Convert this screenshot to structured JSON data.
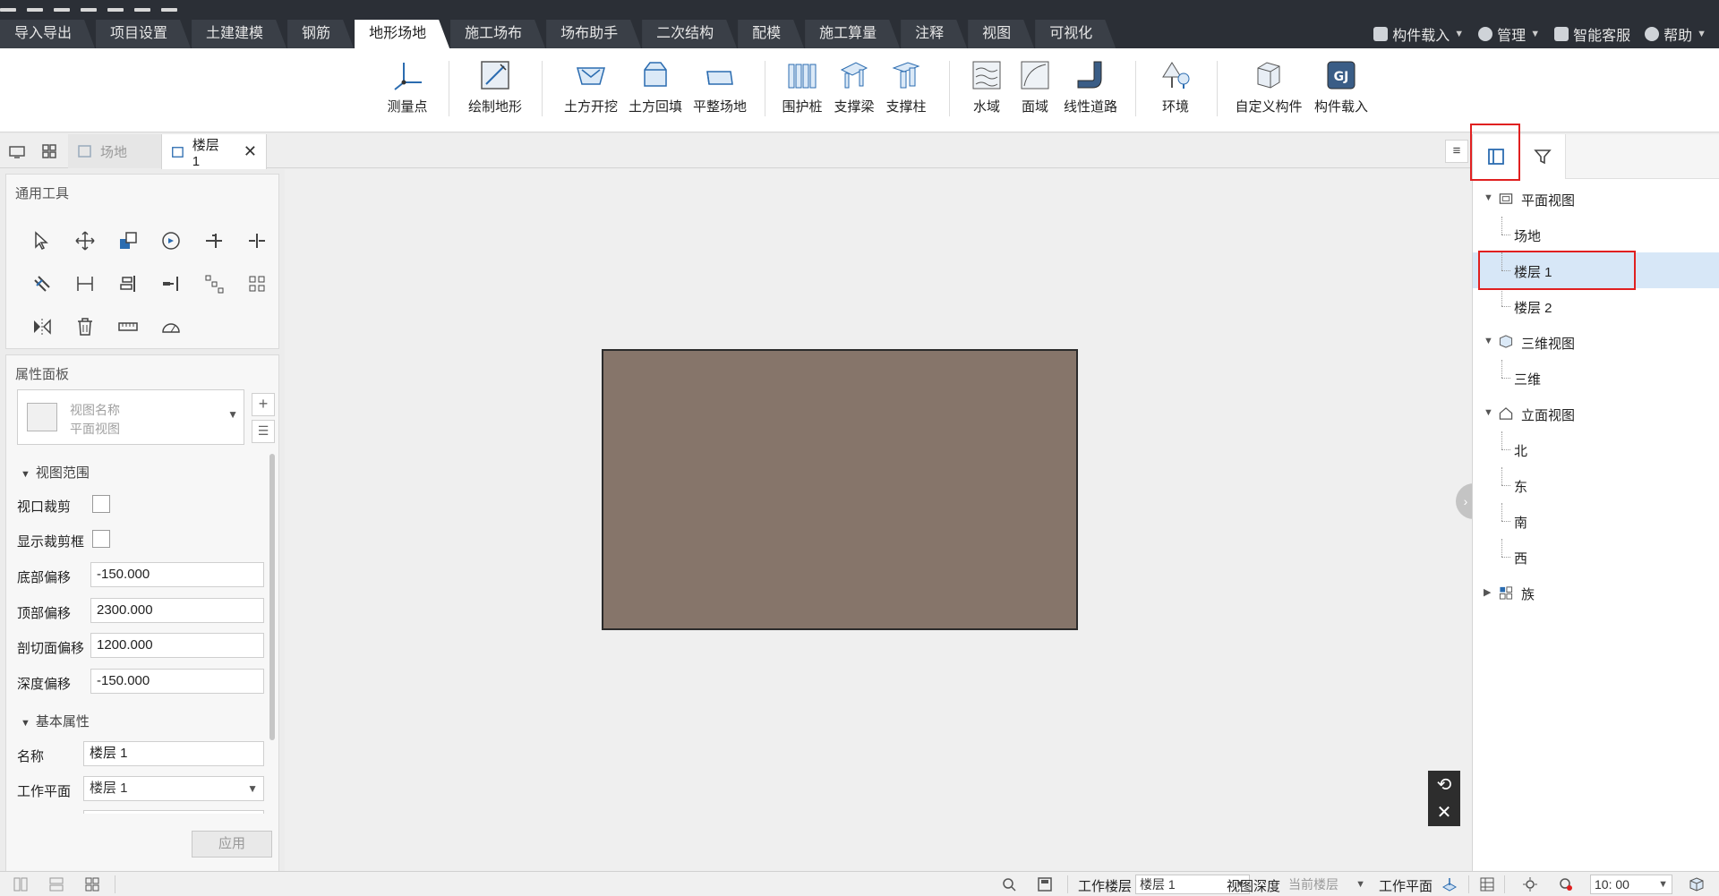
{
  "top_tabs": [
    {
      "label": "导入导出",
      "active": false
    },
    {
      "label": "项目设置",
      "active": false
    },
    {
      "label": "土建建模",
      "active": false
    },
    {
      "label": "钢筋",
      "active": false
    },
    {
      "label": "地形场地",
      "active": true
    },
    {
      "label": "施工场布",
      "active": false
    },
    {
      "label": "场布助手",
      "active": false
    },
    {
      "label": "二次结构",
      "active": false
    },
    {
      "label": "配模",
      "active": false
    },
    {
      "label": "施工算量",
      "active": false
    },
    {
      "label": "注释",
      "active": false
    },
    {
      "label": "视图",
      "active": false
    },
    {
      "label": "可视化",
      "active": false
    }
  ],
  "top_right": {
    "component_load": "构件载入",
    "manage": "管理",
    "smart_service": "智能客服",
    "help": "帮助"
  },
  "ribbon": {
    "survey_point": "测量点",
    "draw_terrain": "绘制地形",
    "excavation": "土方开挖",
    "backfill": "土方回填",
    "level_site": "平整场地",
    "retaining_pile": "围护桩",
    "support_beam": "支撑梁",
    "support_column": "支撑柱",
    "water_area": "水域",
    "surface_area": "面域",
    "linear_road": "线性道路",
    "environment": "环境",
    "custom_component": "自定义构件",
    "component_load": "构件载入"
  },
  "view_tabs": {
    "site_tab": "场地",
    "floor_tab": "楼层 1",
    "close_glyph": "✕"
  },
  "tool_panel": {
    "title": "通用工具"
  },
  "property_panel": {
    "title": "属性面板",
    "type_name_label": "视图名称",
    "type_value": "平面视图",
    "view_range_section": "视图范围",
    "viewport_crop_label": "视口裁剪",
    "viewport_crop_checked": false,
    "show_crop_box_label": "显示裁剪框",
    "show_crop_box_checked": false,
    "bottom_offset_label": "底部偏移",
    "bottom_offset": "-150.000",
    "top_offset_label": "顶部偏移",
    "top_offset": "2300.000",
    "cut_plane_offset_label": "剖切面偏移",
    "cut_plane_offset": "1200.000",
    "depth_offset_label": "深度偏移",
    "depth_offset": "-150.000",
    "basic_props_section": "基本属性",
    "name_label": "名称",
    "name_value": "楼层 1",
    "work_plane_label": "工作平面",
    "work_plane_value": "楼层 1",
    "apply_button": "应用"
  },
  "canvas": {
    "site_fill_color": "#86756a",
    "collapse_glyph": "›",
    "reset_glyph": "⟲",
    "close_glyph": "✕"
  },
  "browser": {
    "tree": [
      {
        "label": "平面视图",
        "level": 0,
        "expanded": true,
        "icon": "plan-view-icon"
      },
      {
        "label": "场地",
        "level": 1
      },
      {
        "label": "楼层 1",
        "level": 1,
        "selected": true
      },
      {
        "label": "楼层 2",
        "level": 1
      },
      {
        "label": "三维视图",
        "level": 0,
        "expanded": true,
        "icon": "3d-view-icon"
      },
      {
        "label": "三维",
        "level": 1
      },
      {
        "label": "立面视图",
        "level": 0,
        "expanded": true,
        "icon": "elevation-view-icon"
      },
      {
        "label": "北",
        "level": 1
      },
      {
        "label": "东",
        "level": 1
      },
      {
        "label": "南",
        "level": 1
      },
      {
        "label": "西",
        "level": 1
      },
      {
        "label": "族",
        "level": 0,
        "expanded": false,
        "icon": "family-icon"
      }
    ]
  },
  "status_bar": {
    "work_floor_label": "工作楼层",
    "work_floor_value": "楼层 1",
    "view_depth_label": "视图深度",
    "view_depth_value": "当前楼层",
    "work_plane_label": "工作平面",
    "scale_value": "10: 00"
  },
  "colors": {
    "highlight": "#e02020",
    "selected_row": "#d7e7f7",
    "topbar": "#2b2f36",
    "accent_blue": "#2b6cb0"
  }
}
